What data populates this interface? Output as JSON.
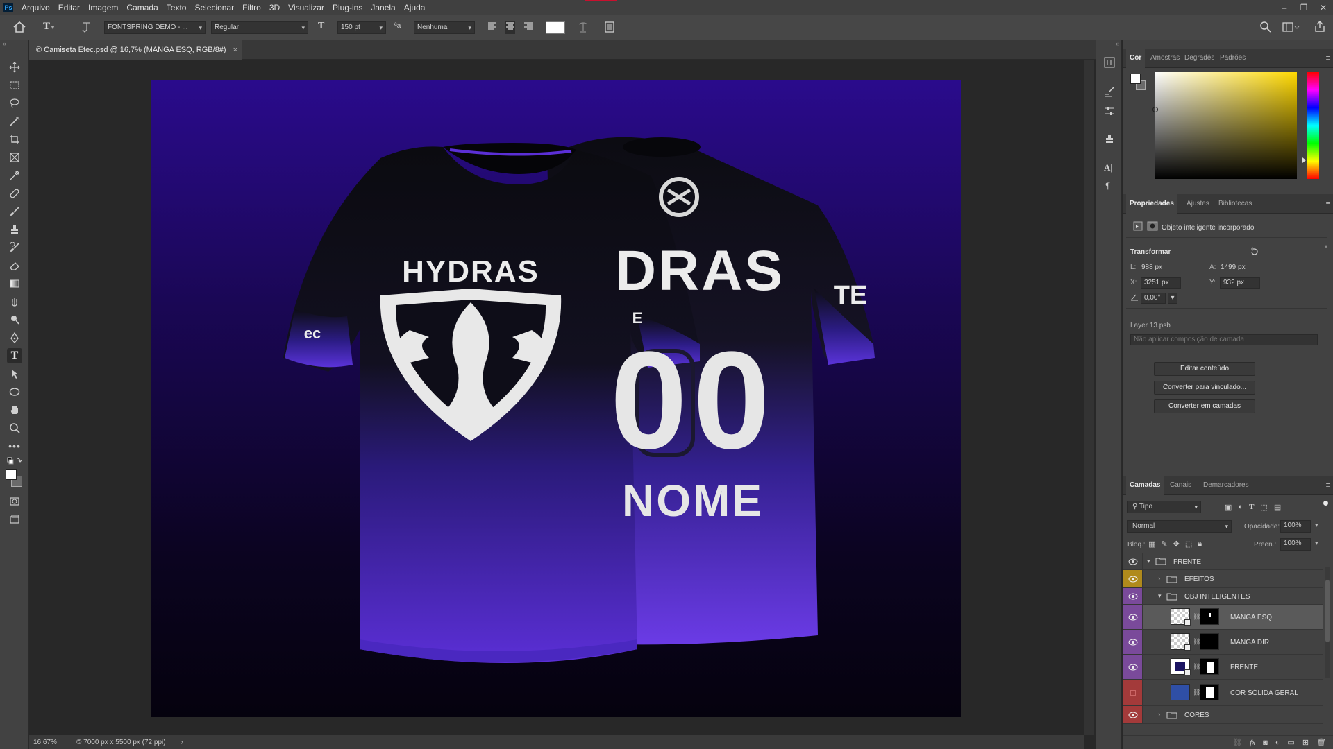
{
  "app": {
    "logo": "Ps"
  },
  "menubar": {
    "items": [
      "Arquivo",
      "Editar",
      "Imagem",
      "Camada",
      "Texto",
      "Selecionar",
      "Filtro",
      "3D",
      "Visualizar",
      "Plug-ins",
      "Janela",
      "Ajuda"
    ]
  },
  "window_controls": {
    "minimize": "–",
    "restore": "❐",
    "close": "✕"
  },
  "options_bar": {
    "font_family": "FONTSPRING DEMO - ...",
    "font_style": "Regular",
    "font_size": "150 pt",
    "aa_label": "ªa",
    "anti_alias": "Nenhuma",
    "text_color": "#ffffff"
  },
  "document": {
    "tab_title": "© Camiseta Etec.psd @ 16,7% (MANGA ESQ, RGB/8#)",
    "close": "×"
  },
  "artwork": {
    "front_team": "HYDRAS",
    "front_sleeve": "ec",
    "back_team": "DRAS",
    "back_sleeve": "TE",
    "back_number": "00",
    "back_name": "NOME",
    "back_side_letter": "E",
    "colors": {
      "purple": "#5b2fd6",
      "deep_purple": "#2a0b8c",
      "shirt_black": "#0b0b0f"
    }
  },
  "status": {
    "zoom": "16,67%",
    "dimensions": "© 7000 px x 5500 px (72 ppi)",
    "arrow": "›"
  },
  "color_panel": {
    "tabs": [
      "Cor",
      "Amostras",
      "Degradês",
      "Padrões"
    ],
    "active": "Cor"
  },
  "properties_panel": {
    "tabs": [
      "Propriedades",
      "Ajustes",
      "Bibliotecas"
    ],
    "active": "Propriedades",
    "object_type": "Objeto inteligente incorporado",
    "section": "Transformar",
    "w_label": "L:",
    "w_value": "988 px",
    "h_label": "A:",
    "h_value": "1499 px",
    "x_label": "X:",
    "x_value": "3251 px",
    "y_label": "Y:",
    "y_value": "932 px",
    "angle_value": "0,00°",
    "source_file": "Layer 13.psb",
    "comp_placeholder": "Não aplicar composição de camada",
    "buttons": [
      "Editar conteúdo",
      "Converter para vinculado...",
      "Converter em camadas"
    ]
  },
  "layers_panel": {
    "tabs": [
      "Camadas",
      "Canais",
      "Demarcadores"
    ],
    "active": "Camadas",
    "filter_kind": "Tipo",
    "blend_mode": "Normal",
    "opacity_label": "Opacidade:",
    "opacity": "100%",
    "lock_label": "Bloq.:",
    "fill_label": "Preen.:",
    "fill": "100%",
    "layers": [
      {
        "name": "FRENTE",
        "type": "group",
        "tag_color": "none"
      },
      {
        "name": "EFEITOS",
        "type": "group",
        "tag_color": "#b08a1c"
      },
      {
        "name": "OBJ INTELIGENTES",
        "type": "group",
        "tag_color": "#7a4a9a"
      },
      {
        "name": "MANGA ESQ",
        "type": "smart",
        "tag_color": "#7a4a9a",
        "selected": true
      },
      {
        "name": "MANGA DIR",
        "type": "smart",
        "tag_color": "#7a4a9a"
      },
      {
        "name": "FRENTE",
        "type": "smart",
        "tag_color": "#7a4a9a"
      },
      {
        "name": "COR SÓLIDA GERAL",
        "type": "fill",
        "tag_color": "#a33a3a"
      },
      {
        "name": "CORES",
        "type": "group",
        "tag_color": "#a33a3a"
      }
    ]
  }
}
